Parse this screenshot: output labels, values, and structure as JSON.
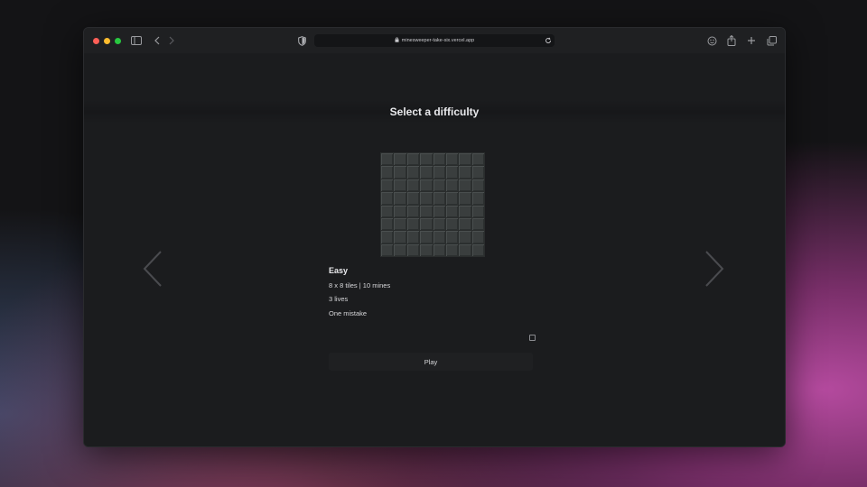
{
  "browser": {
    "url": "minesweeper-take-six.vercel.app",
    "icons": [
      "sidebar-icon",
      "back-icon",
      "forward-icon",
      "shield-icon",
      "lock-icon",
      "reload-icon",
      "extension-icon",
      "share-icon",
      "new-tab-icon",
      "tabs-icon"
    ]
  },
  "colors": {
    "close": "#ff5f57",
    "minimize": "#febc2e",
    "zoom": "#28c840"
  },
  "page": {
    "title": "Select a difficulty",
    "difficulty": {
      "name": "Easy",
      "size": "8 x 8 tiles | 10 mines",
      "lives": "3 lives",
      "option_label": "One mistake",
      "option_checked": false
    },
    "play_label": "Play",
    "grid": {
      "rows": 8,
      "cols": 8
    }
  }
}
